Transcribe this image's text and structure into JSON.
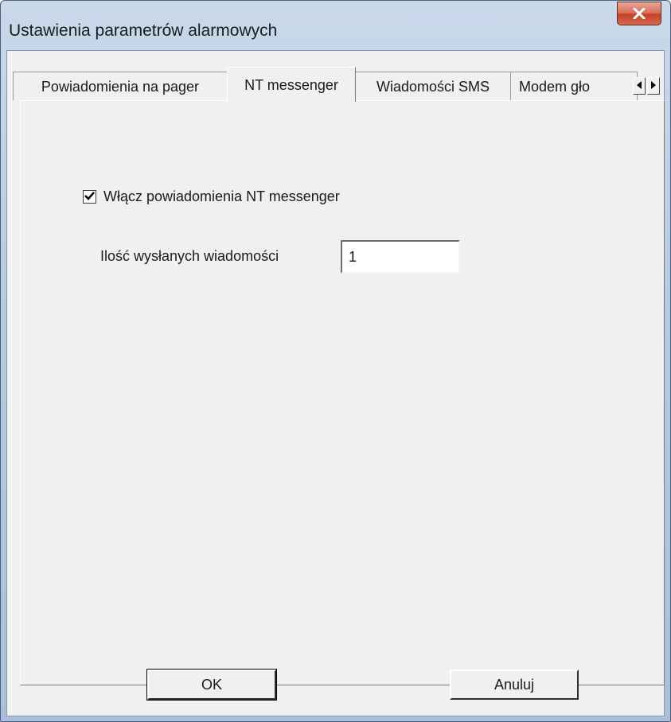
{
  "window": {
    "title": "Ustawienia parametrów alarmowych"
  },
  "tabs": [
    {
      "label": "Powiadomienia na pager",
      "active": false
    },
    {
      "label": "NT messenger",
      "active": true
    },
    {
      "label": "Wiadomości SMS",
      "active": false
    },
    {
      "label": "Modem gło",
      "active": false
    }
  ],
  "tab_scroll": {
    "left_icon": "arrow-left-icon",
    "right_icon": "arrow-right-icon"
  },
  "panel": {
    "enable_checkbox": {
      "label": "Włącz powiadomienia NT messenger",
      "checked": true
    },
    "message_count": {
      "label": "Ilość wysłanych wiadomości",
      "value": "1"
    }
  },
  "buttons": {
    "ok_label": "OK",
    "cancel_label": "Anuluj"
  },
  "colors": {
    "close_button": "#c2432a",
    "dialog_background": "#f0f0f0"
  }
}
